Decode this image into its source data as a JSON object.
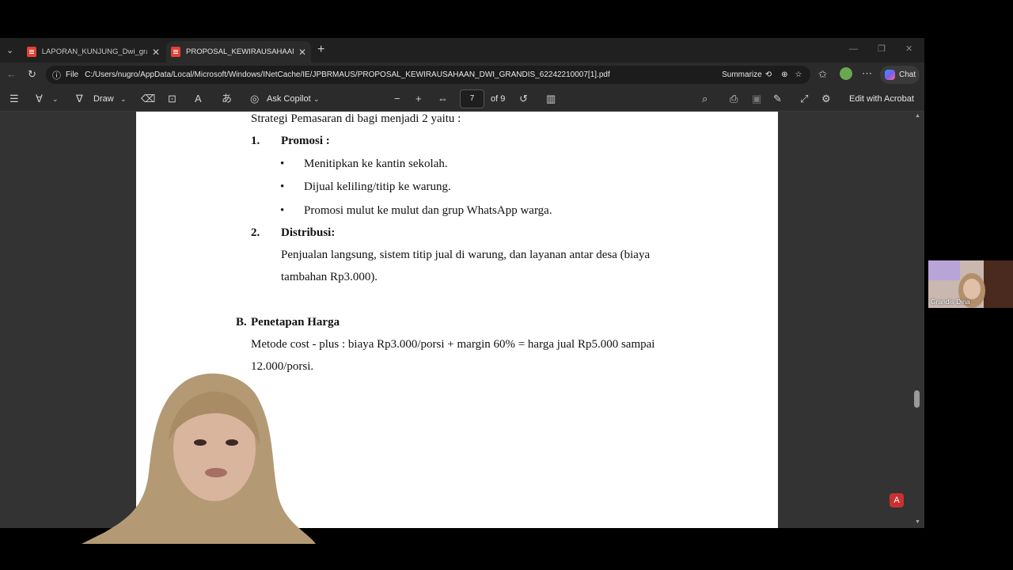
{
  "tabs": [
    {
      "label": "LAPORAN_KUNJUNG_Dwi_grandis",
      "active": false
    },
    {
      "label": "PROPOSAL_KEWIRAUSAHAAN_DWI_GRANDIS",
      "active": true
    }
  ],
  "address": {
    "scheme_label": "File",
    "url": "C:/Users/nugro/AppData/Local/Microsoft/Windows/INetCache/IE/JPBRMAUS/PROPOSAL_KEWIRAUSAHAAN_DWI_GRANDIS_62242210007[1].pdf",
    "summarize_label": "Summarize",
    "chat_label": "Chat"
  },
  "pdf_toolbar": {
    "draw_label": "Draw",
    "ask_copilot_label": "Ask Copilot",
    "page_current": "7",
    "page_total": "of 9",
    "edit_label": "Edit with Acrobat"
  },
  "document": {
    "intro": "Strategi Pemasaran di bagi menjadi 2 yaitu :",
    "item1_num": "1.",
    "item1_title": "Promosi :",
    "bullets": [
      "Menitipkan ke kantin sekolah.",
      "Dijual keliling/titip ke warung.",
      "Promosi mulut ke mulut dan grup WhatsApp warga."
    ],
    "item2_num": "2.",
    "item2_title": "Distribusi:",
    "item2_line1": "Penjualan langsung, sistem titip jual di warung, dan layanan antar desa (biaya",
    "item2_line2": "tambahan Rp3.000).",
    "sectionB_label": "B.",
    "sectionB_title": "Penetapan Harga",
    "sectionB_line1": "Metode cost - plus : biaya Rp3.000/porsi + margin 60% = harga jual Rp5.000 sampai",
    "sectionB_line2": "12.000/porsi."
  },
  "participant": {
    "name": "Grandis Dina"
  },
  "colors": {
    "acrobat_red": "#c8312f",
    "copilot_accent": "#7b5cf0"
  }
}
